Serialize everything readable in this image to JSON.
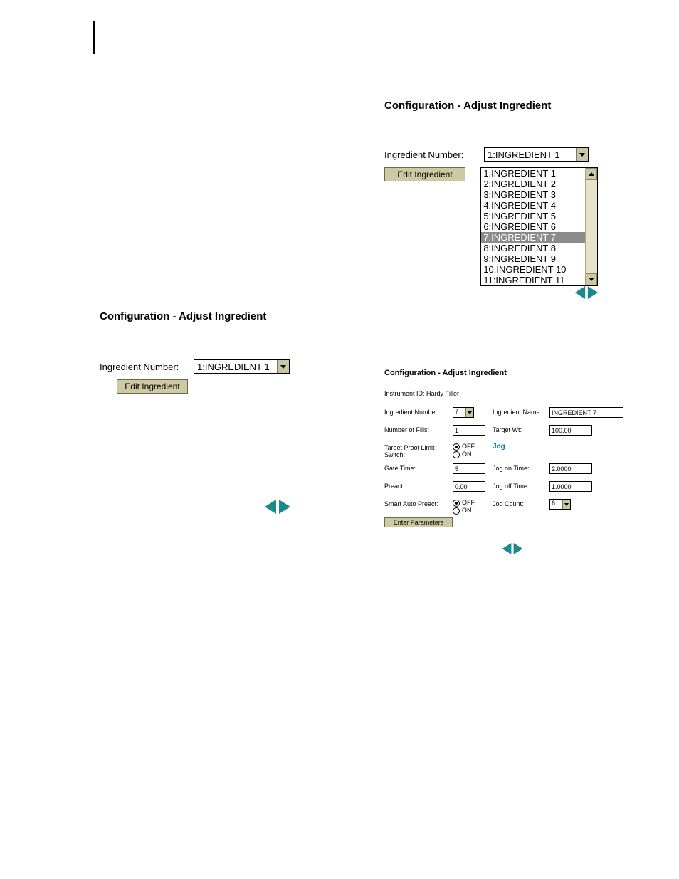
{
  "panel_top_right": {
    "title": "Configuration - Adjust Ingredient",
    "ingredient_number_label": "Ingredient Number:",
    "ingredient_number_value": "1:INGREDIENT 1",
    "edit_button": "Edit Ingredient",
    "list_items": [
      "1:INGREDIENT 1",
      "2:INGREDIENT 2",
      "3:INGREDIENT 3",
      "4:INGREDIENT 4",
      "5:INGREDIENT 5",
      "6:INGREDIENT 6",
      "7:INGREDIENT 7",
      "8:INGREDIENT 8",
      "9:INGREDIENT 9",
      "10:INGREDIENT 10",
      "11:INGREDIENT 11"
    ],
    "selected_index": 6
  },
  "panel_left": {
    "title": "Configuration - Adjust Ingredient",
    "ingredient_number_label": "Ingredient Number:",
    "ingredient_number_value": "1:INGREDIENT 1",
    "edit_button": "Edit Ingredient"
  },
  "panel_detail": {
    "title": "Configuration - Adjust Ingredient",
    "instrument_id_label": "Instrument ID: Hardy Filler",
    "labels": {
      "ingredient_number": "Ingredient Number:",
      "ingredient_name": "Ingredient Name:",
      "number_of_fills": "Number of Fills:",
      "target_wt": "Target Wt:",
      "target_proof_limit_switch": "Target Proof Limit Switch:",
      "jog_header": "Jog",
      "gate_time": "Gate Time:",
      "jog_on_time": "Jog on Time:",
      "preact": "Preact:",
      "jog_off_time": "Jog off Time:",
      "smart_auto_preact": "Smart Auto Preact:",
      "jog_count": "Jog Count:"
    },
    "values": {
      "ingredient_number": "7",
      "ingredient_name": "INGREDIENT 7",
      "number_of_fills": "1",
      "target_wt": "100.00",
      "target_proof_limit_switch": "OFF",
      "gate_time": "5",
      "jog_on_time": "2.0000",
      "preact": "0.00",
      "jog_off_time": "1.0000",
      "smart_auto_preact": "OFF",
      "jog_count": "6"
    },
    "radio_options": {
      "off": "OFF",
      "on": "ON"
    },
    "enter_button": "Enter Parameters"
  }
}
